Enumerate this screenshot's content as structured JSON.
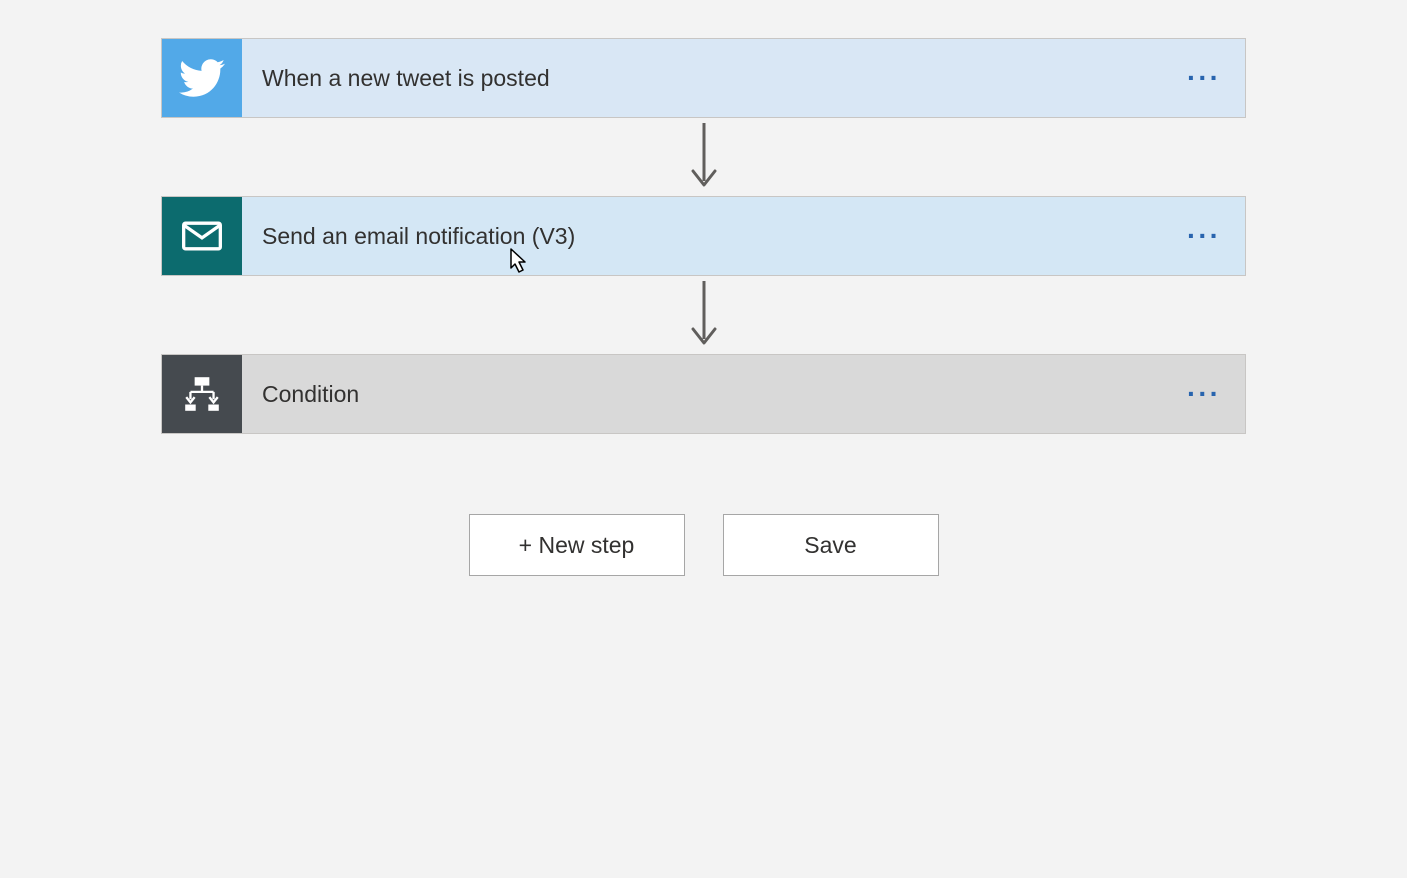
{
  "steps": {
    "trigger": {
      "label": "When a new tweet is posted"
    },
    "action1": {
      "label": "Send an email notification (V3)"
    },
    "condition": {
      "label": "Condition"
    }
  },
  "buttons": {
    "new_step": "+ New step",
    "save": "Save"
  },
  "icons": {
    "more": "···"
  }
}
